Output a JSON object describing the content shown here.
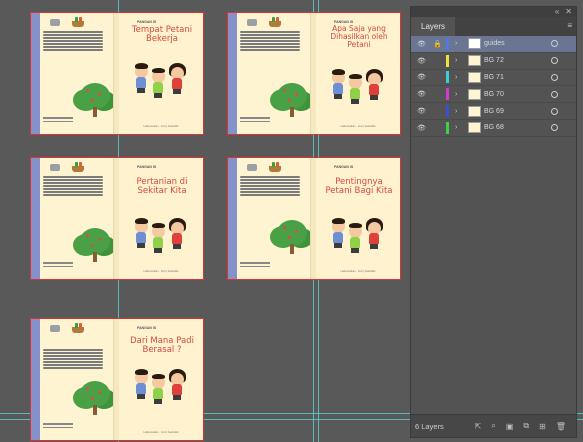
{
  "books": [
    {
      "id": "b1",
      "series": "PANGAN IS",
      "title": "Tempat Petani Bekerja",
      "author": "Lalita Hadian  ·  Ferry Saefullah"
    },
    {
      "id": "b2",
      "series": "PANGAN IS",
      "title": "Apa Saja yang Dihasilkan oleh Petani",
      "author": "Lalita Hadian  ·  Ferry Saefullah"
    },
    {
      "id": "b3",
      "series": "PANGAN IS",
      "title": "Pertanian di Sekitar Kita",
      "author": "Lalita Hadian  ·  Ferry Saefullah"
    },
    {
      "id": "b4",
      "series": "PANGAN IS",
      "title": "Pentingnya Petani Bagi Kita",
      "author": "Lalita Hadian  ·  Ferry Saefullah"
    },
    {
      "id": "b5",
      "series": "PANGAN IS",
      "title": "Dari Mana Padi Berasal ?",
      "author": "Lalita Hadian  ·  Ferry Saefullah"
    }
  ],
  "layers_panel": {
    "tab_label": "Layers",
    "count_label": "6 Layers",
    "layers": [
      {
        "name": "guides",
        "color": "#4f7bdb",
        "selected": true,
        "locked": true,
        "thumb": "white"
      },
      {
        "name": "BG 72",
        "color": "#f0e23a",
        "selected": false,
        "locked": false,
        "thumb": "book"
      },
      {
        "name": "BG 71",
        "color": "#38cfd4",
        "selected": false,
        "locked": false,
        "thumb": "book"
      },
      {
        "name": "BG 70",
        "color": "#d03cd0",
        "selected": false,
        "locked": false,
        "thumb": "book"
      },
      {
        "name": "BG 69",
        "color": "#3b4fd6",
        "selected": false,
        "locked": false,
        "thumb": "book"
      },
      {
        "name": "BG 68",
        "color": "#3bd24a",
        "selected": false,
        "locked": false,
        "thumb": "book"
      }
    ]
  }
}
